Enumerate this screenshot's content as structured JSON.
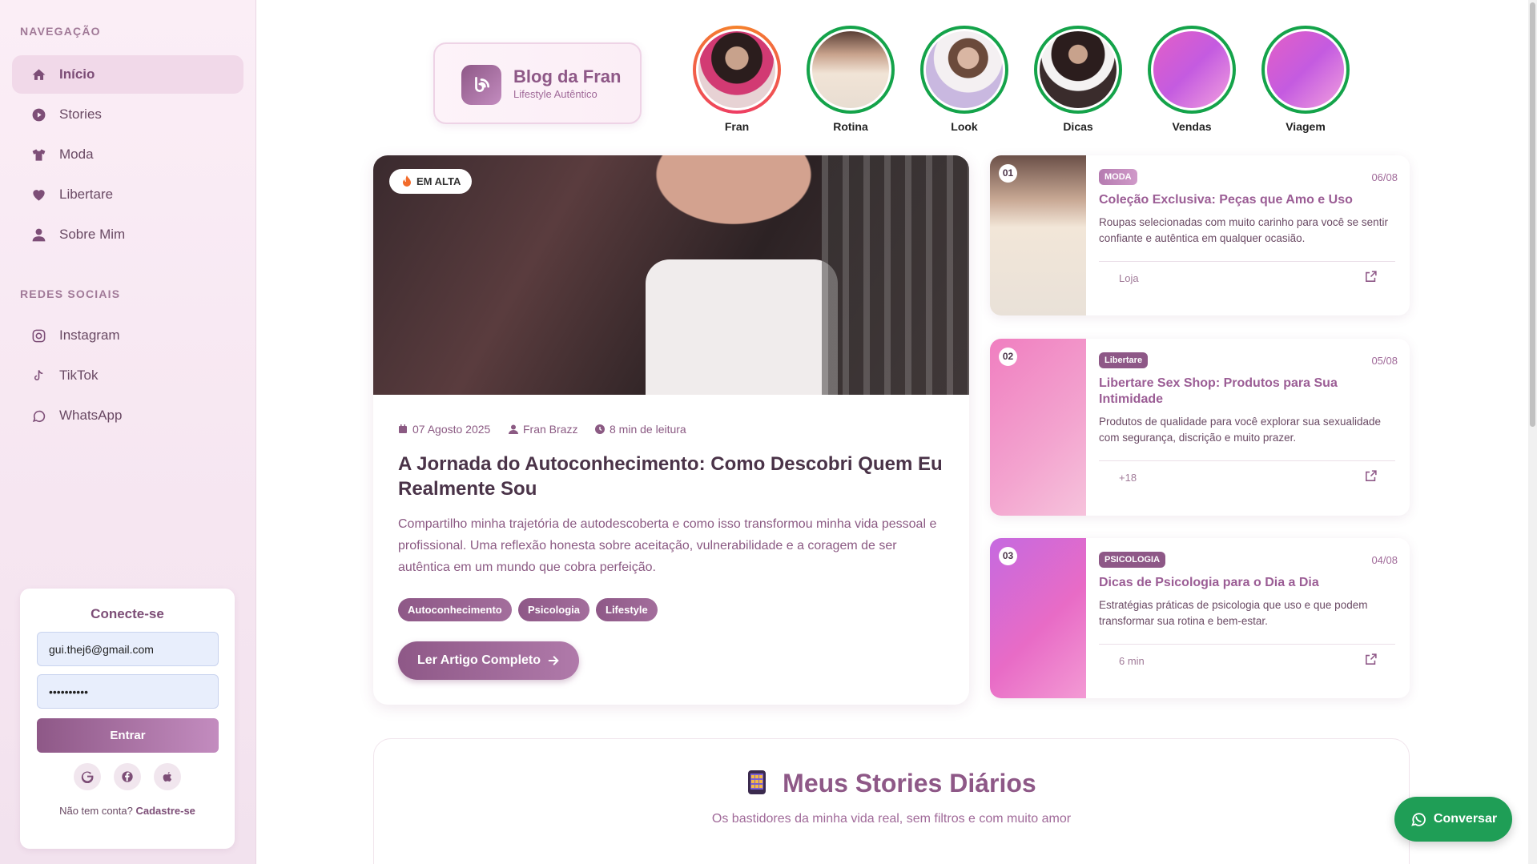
{
  "sidebar": {
    "nav_heading": "NAVEGAÇÃO",
    "nav": [
      {
        "label": "Início",
        "icon": "home-icon"
      },
      {
        "label": "Stories",
        "icon": "play-circle-icon"
      },
      {
        "label": "Moda",
        "icon": "shirt-icon"
      },
      {
        "label": "Libertare",
        "icon": "heart-icon"
      },
      {
        "label": "Sobre Mim",
        "icon": "user-icon"
      }
    ],
    "social_heading": "REDES SOCIAIS",
    "social": [
      {
        "label": "Instagram",
        "icon": "instagram-icon"
      },
      {
        "label": "TikTok",
        "icon": "tiktok-icon"
      },
      {
        "label": "WhatsApp",
        "icon": "whatsapp-icon"
      }
    ],
    "login": {
      "title": "Conecte-se",
      "email": "gui.thej6@gmail.com",
      "password": "••••••••••",
      "button": "Entrar",
      "signup_text": "Não tem conta?",
      "signup_link": "Cadastre-se"
    }
  },
  "logo": {
    "title": "Blog da Fran",
    "subtitle": "Lifestyle Autêntico"
  },
  "stories": [
    {
      "label": "Fran"
    },
    {
      "label": "Rotina"
    },
    {
      "label": "Look"
    },
    {
      "label": "Dicas"
    },
    {
      "label": "Vendas"
    },
    {
      "label": "Viagem"
    }
  ],
  "featured": {
    "badge": "EM ALTA",
    "date": "07 Agosto 2025",
    "author": "Fran Brazz",
    "read_time": "8 min de leitura",
    "title": "A Jornada do Autoconhecimento: Como Descobri Quem Eu Realmente Sou",
    "description": "Compartilho minha trajetória de autodescoberta e como isso transformou minha vida pessoal e profissional. Uma reflexão honesta sobre aceitação, vulnerabilidade e a coragem de ser autêntica em um mundo que cobra perfeição.",
    "tags": [
      "Autoconhecimento",
      "Psicologia",
      "Lifestyle"
    ],
    "button": "Ler Artigo Completo"
  },
  "cards": [
    {
      "num": "01",
      "category": "MODA",
      "date": "06/08",
      "title": "Coleção Exclusiva: Peças que Amo e Uso",
      "description": "Roupas selecionadas com muito carinho para você se sentir confiante e autêntica em qualquer ocasião.",
      "footer": "Loja"
    },
    {
      "num": "02",
      "category": "Libertare",
      "date": "05/08",
      "title": "Libertare Sex Shop: Produtos para Sua Intimidade",
      "description": "Produtos de qualidade para você explorar sua sexualidade com segurança, discrição e muito prazer.",
      "footer": "+18"
    },
    {
      "num": "03",
      "category": "PSICOLOGIA",
      "date": "04/08",
      "title": "Dicas de Psicologia para o Dia a Dia",
      "description": "Estratégias práticas de psicologia que uso e que podem transformar sua rotina e bem-estar.",
      "footer": "6 min"
    }
  ],
  "stories_section": {
    "title": "Meus Stories Diários",
    "subtitle": "Os bastidores da minha vida real, sem filtros e com muito amor"
  },
  "chat_button": "Conversar"
}
